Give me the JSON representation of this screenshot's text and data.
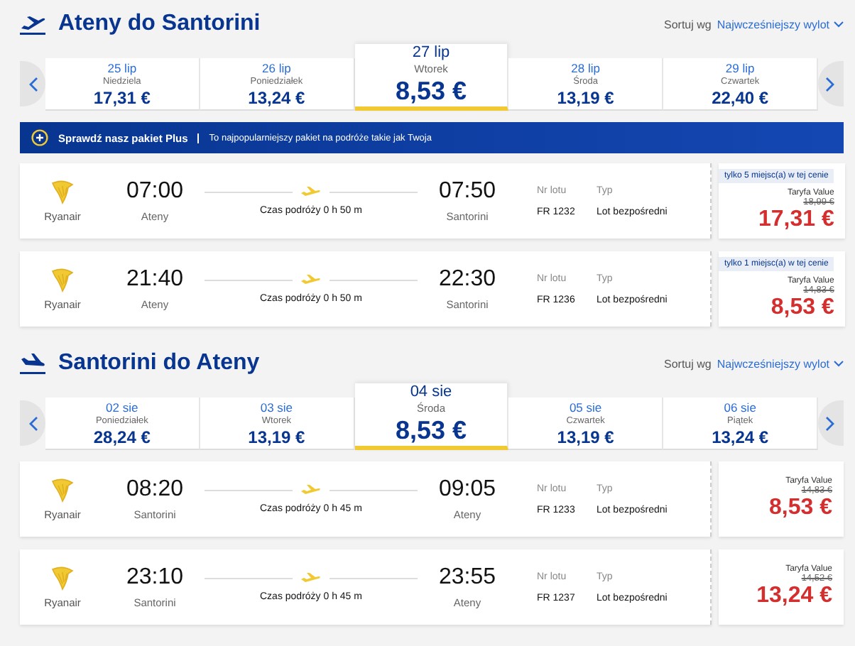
{
  "sections": [
    {
      "title": "Ateny do Santorini",
      "kind": "departure",
      "sort_label": "Sortuj wg",
      "sort_value": "Najwcześniejszy wylot",
      "dates": [
        {
          "date": "25 lip",
          "day": "Niedziela",
          "price": "17,31 €",
          "selected": false
        },
        {
          "date": "26 lip",
          "day": "Poniedziałek",
          "price": "13,24 €",
          "selected": false
        },
        {
          "date": "27 lip",
          "day": "Wtorek",
          "price": "8,53 €",
          "selected": true
        },
        {
          "date": "28 lip",
          "day": "Środa",
          "price": "13,19 €",
          "selected": false
        },
        {
          "date": "29 lip",
          "day": "Czwartek",
          "price": "22,40 €",
          "selected": false
        }
      ],
      "banner": {
        "title": "Sprawdź nasz pakiet Plus",
        "text": "To najpopularniejszy pakiet na podróże takie jak Twoja"
      },
      "flights": [
        {
          "airline": "Ryanair",
          "dep_time": "07:00",
          "dep_city": "Ateny",
          "duration": "Czas podróży 0 h 50 m",
          "arr_time": "07:50",
          "arr_city": "Santorini",
          "flight_no_label": "Nr lotu",
          "flight_no": "FR 1232",
          "type_label": "Typ",
          "type": "Lot bezpośredni",
          "badge": "tylko 5 miejsc(a) w tej cenie",
          "fare": "Taryfa Value",
          "old_price": "18,99 €",
          "price": "17,31 €"
        },
        {
          "airline": "Ryanair",
          "dep_time": "21:40",
          "dep_city": "Ateny",
          "duration": "Czas podróży 0 h 50 m",
          "arr_time": "22:30",
          "arr_city": "Santorini",
          "flight_no_label": "Nr lotu",
          "flight_no": "FR 1236",
          "type_label": "Typ",
          "type": "Lot bezpośredni",
          "badge": "tylko 1 miejsc(a) w tej cenie",
          "fare": "Taryfa Value",
          "old_price": "14,83 €",
          "price": "8,53 €"
        }
      ]
    },
    {
      "title": "Santorini do Ateny",
      "kind": "arrival",
      "sort_label": "Sortuj wg",
      "sort_value": "Najwcześniejszy wylot",
      "dates": [
        {
          "date": "02 sie",
          "day": "Poniedziałek",
          "price": "28,24 €",
          "selected": false
        },
        {
          "date": "03 sie",
          "day": "Wtorek",
          "price": "13,19 €",
          "selected": false
        },
        {
          "date": "04 sie",
          "day": "Środa",
          "price": "8,53 €",
          "selected": true
        },
        {
          "date": "05 sie",
          "day": "Czwartek",
          "price": "13,19 €",
          "selected": false
        },
        {
          "date": "06 sie",
          "day": "Piątek",
          "price": "13,24 €",
          "selected": false
        }
      ],
      "flights": [
        {
          "airline": "Ryanair",
          "dep_time": "08:20",
          "dep_city": "Santorini",
          "duration": "Czas podróży 0 h 45 m",
          "arr_time": "09:05",
          "arr_city": "Ateny",
          "flight_no_label": "Nr lotu",
          "flight_no": "FR 1233",
          "type_label": "Typ",
          "type": "Lot bezpośredni",
          "fare": "Taryfa Value",
          "old_price": "14,83 €",
          "price": "8,53 €"
        },
        {
          "airline": "Ryanair",
          "dep_time": "23:10",
          "dep_city": "Santorini",
          "duration": "Czas podróży 0 h 45 m",
          "arr_time": "23:55",
          "arr_city": "Ateny",
          "flight_no_label": "Nr lotu",
          "flight_no": "FR 1237",
          "type_label": "Typ",
          "type": "Lot bezpośredni",
          "fare": "Taryfa Value",
          "old_price": "14,52 €",
          "price": "13,24 €"
        }
      ]
    }
  ]
}
